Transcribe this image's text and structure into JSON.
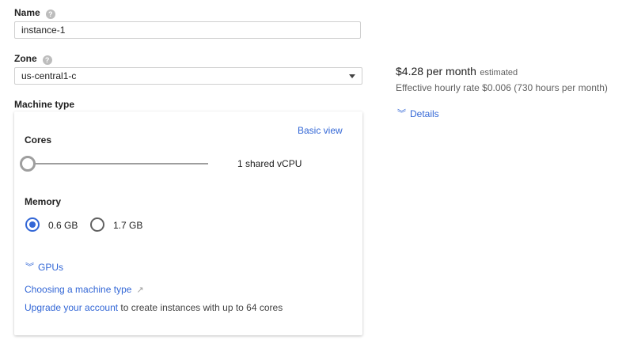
{
  "name": {
    "label": "Name",
    "value": "instance-1"
  },
  "zone": {
    "label": "Zone",
    "value": "us-central1-c"
  },
  "machine_type": {
    "label": "Machine type",
    "basic_view_link": "Basic view",
    "cores_label": "Cores",
    "cores_value": "1 shared vCPU",
    "cores_slider_fraction": 0,
    "memory_label": "Memory",
    "memory_options": [
      "0.6 GB",
      "1.7 GB"
    ],
    "memory_selected": "0.6 GB",
    "gpus_link": "GPUs",
    "choosing_link": "Choosing a machine type",
    "upgrade_link": "Upgrade your account",
    "upgrade_text": " to create instances with up to 64 cores"
  },
  "pricing": {
    "price": "$4.28 per month",
    "estimated": "estimated",
    "hourly": "Effective hourly rate $0.006 (730 hours per month)",
    "details_link": "Details"
  },
  "colors": {
    "link": "#3367d6",
    "radio_checked": "#3367d6",
    "slider": "#9e9e9e"
  },
  "icons": {
    "help": "help-circle-icon",
    "dropdown": "caret-down-icon",
    "expand": "chevron-double-down-icon",
    "external": "external-link-icon"
  }
}
